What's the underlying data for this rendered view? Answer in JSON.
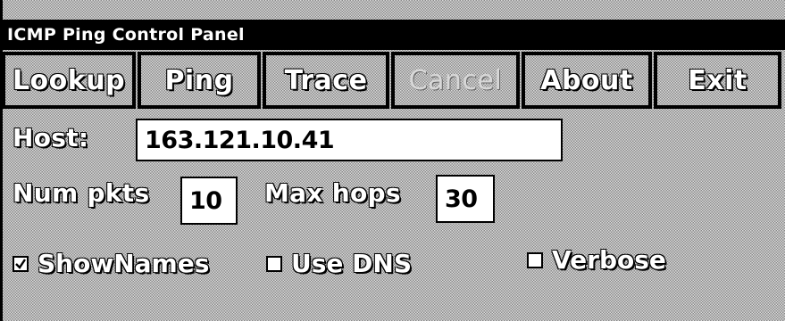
{
  "window": {
    "title": "ICMP Ping Control Panel"
  },
  "toolbar": {
    "lookup": "Lookup",
    "ping": "Ping",
    "trace": "Trace",
    "cancel": "Cancel",
    "about": "About",
    "exit": "Exit"
  },
  "form": {
    "host_label": "Host:",
    "host_value": "163.121.10.41",
    "num_pkts_label": "Num pkts",
    "num_pkts_value": "10",
    "max_hops_label": "Max hops",
    "max_hops_value": "30"
  },
  "options": {
    "show_names": {
      "label": "ShowNames",
      "checked": true
    },
    "use_dns": {
      "label": "Use DNS",
      "checked": false
    },
    "verbose": {
      "label": "Verbose",
      "checked": false
    }
  }
}
